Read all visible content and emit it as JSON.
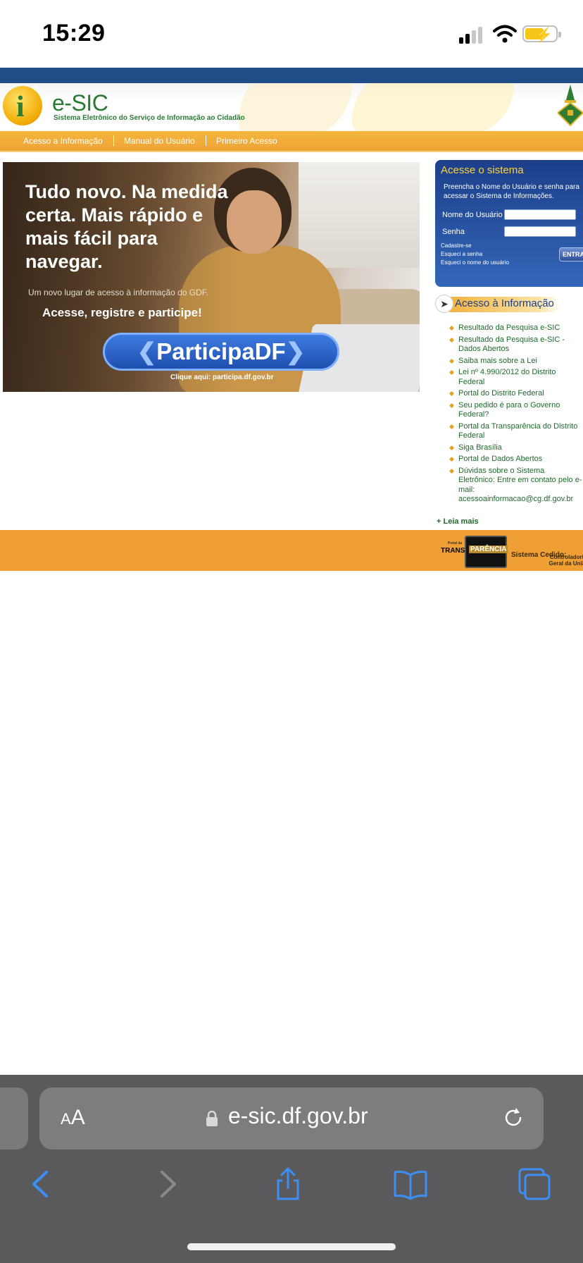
{
  "status_bar": {
    "time": "15:29",
    "battery_color": "#f5c518"
  },
  "site": {
    "brand": "e-SIC",
    "brand_subtitle": "Sistema Eletrônico do Serviço de Informação ao Cidadão",
    "logo_letter": "i",
    "colors": {
      "top_band": "#1f4d88",
      "nav": "#efa335",
      "brand_green": "#2a7a34",
      "footer": "#ef9f34"
    }
  },
  "nav": {
    "items": [
      "Acesso a Informação",
      "Manual do Usuário",
      "Primeiro Acesso"
    ]
  },
  "banner": {
    "headline": "Tudo novo. Na medida certa. Mais rápido e mais fácil para navegar.",
    "subtitle": "Um novo lugar de acesso à informação do GDF.",
    "cta": "Acesse, registre e participe!",
    "button": "ParticipaDF",
    "click_text": "Clique aqui: participa.df.gov.br"
  },
  "login": {
    "title": "Acesse o sistema",
    "description": "Preencha o Nome do Usuário e senha para acessar o Sistema de Informações.",
    "username_label": "Nome do Usuário",
    "password_label": "Senha",
    "links": [
      "Cadastre-se",
      "Esqueci a senha",
      "Esqueci o nome do usuário"
    ],
    "submit": "ENTRA"
  },
  "info": {
    "title": "Acesso à Informação",
    "items": [
      "Resultado da Pesquisa e-SIC",
      "Resultado da Pesquisa e-SIC - Dados Abertos",
      "Saiba mais sobre a Lei",
      "Lei nº 4.990/2012 do Distrito Federal",
      "Portal do Distrito Federal",
      "Seu pedido é para o Governo Federal?",
      "Portal da Transparência do Distrito Federal",
      "Siga Brasília",
      "Portal de Dados Abertos",
      "Dúvidas sobre o Sistema Eletrônico: Entre em contato pelo e-mail: acessoainformacao@cg.df.gov.br"
    ],
    "more": "+ Leia mais"
  },
  "footer": {
    "portal_small": "Portal da",
    "portal_trans": "TRANS",
    "portal_box": "PARÊNCIA",
    "cedido": "Sistema Cedido:",
    "cgdf": "Controladoria-Geral da União"
  },
  "safari": {
    "aa_label": "AA",
    "url": "e-sic.df.gov.br",
    "icons": [
      "back-icon",
      "forward-icon",
      "share-icon",
      "bookmarks-icon",
      "tabs-icon"
    ]
  }
}
